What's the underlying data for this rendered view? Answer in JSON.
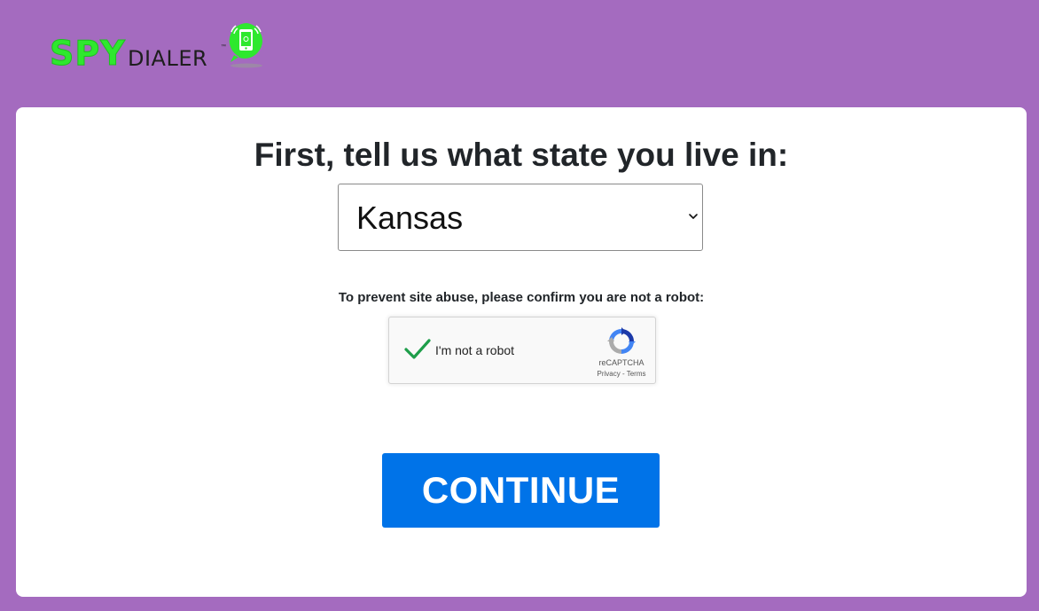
{
  "brand": {
    "logo_primary": "SPY",
    "logo_secondary": "DIALER",
    "trademark": "TM",
    "primary_color": "#2ee82e",
    "background_color": "#a46bbf"
  },
  "form": {
    "heading": "First, tell us what state you live in:",
    "state_select": {
      "selected_value": "Kansas",
      "icon": "chevron-down-icon"
    },
    "robot_prompt": "To prevent site abuse, please confirm you are not a robot:",
    "captcha": {
      "checkbox_checked": true,
      "label": "I'm not a robot",
      "brand": "reCAPTCHA",
      "privacy_link": "Privacy",
      "separator": " - ",
      "terms_link": "Terms"
    },
    "continue_label": "CONTINUE",
    "continue_color": "#0073e8"
  }
}
